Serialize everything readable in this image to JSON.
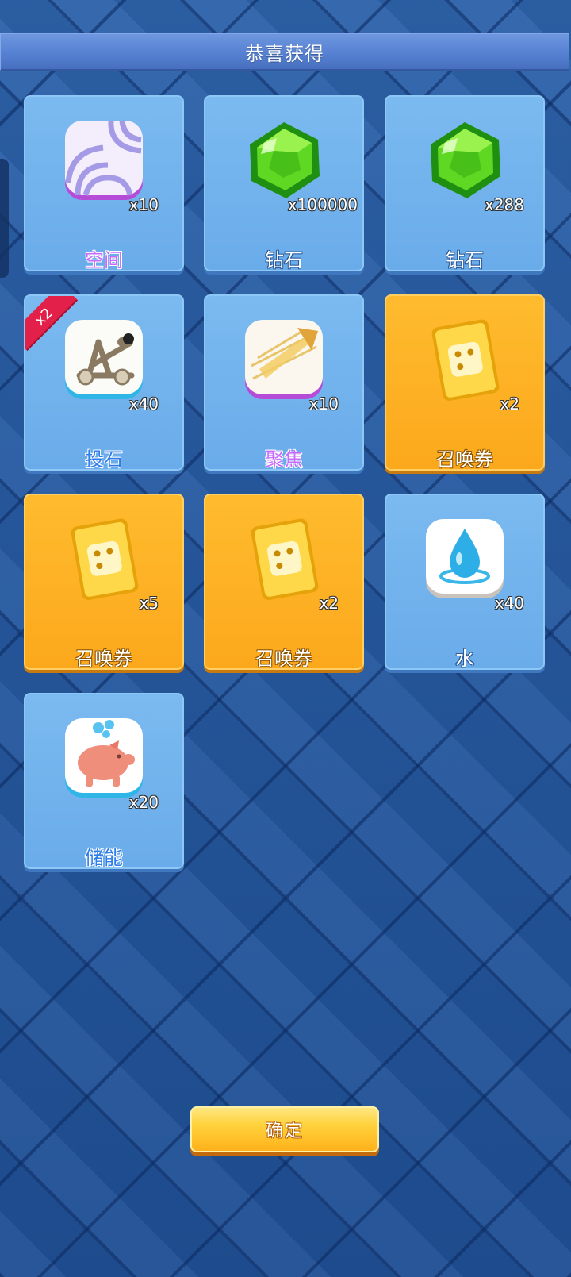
{
  "header": {
    "title": "恭喜获得"
  },
  "rewards": [
    {
      "name": "空间",
      "count": "x10",
      "icon": "space-skill-icon",
      "badge": ""
    },
    {
      "name": "钻石",
      "count": "x100000",
      "icon": "diamond-icon",
      "badge": ""
    },
    {
      "name": "钻石",
      "count": "x288",
      "icon": "diamond-icon",
      "badge": ""
    },
    {
      "name": "投石",
      "count": "x40",
      "icon": "catapult-icon",
      "badge": "x2"
    },
    {
      "name": "聚焦",
      "count": "x10",
      "icon": "focus-skill-icon",
      "badge": ""
    },
    {
      "name": "召唤券",
      "count": "x2",
      "icon": "summon-ticket-icon",
      "badge": ""
    },
    {
      "name": "召唤券",
      "count": "x5",
      "icon": "summon-ticket-icon",
      "badge": ""
    },
    {
      "name": "召唤券",
      "count": "x2",
      "icon": "summon-ticket-icon",
      "badge": ""
    },
    {
      "name": "水",
      "count": "x40",
      "icon": "water-drop-icon",
      "badge": ""
    },
    {
      "name": "储能",
      "count": "x20",
      "icon": "piggy-bank-icon",
      "badge": ""
    }
  ],
  "confirm": {
    "label": "确定"
  },
  "colors": {
    "card_blue": "#6aacea",
    "card_gold": "#fca81c",
    "name_purple": "#c76bff",
    "name_blue": "#2f7de8",
    "badge_red": "#e2204a"
  }
}
